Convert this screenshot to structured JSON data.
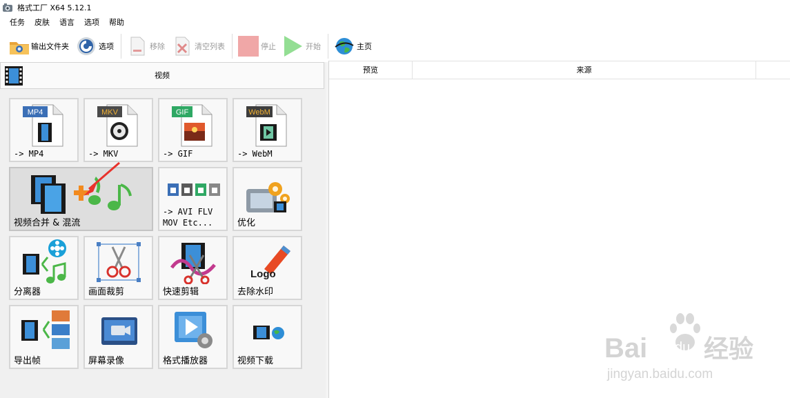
{
  "window": {
    "title": "格式工厂 X64 5.12.1"
  },
  "menu": [
    "任务",
    "皮肤",
    "语言",
    "选项",
    "帮助"
  ],
  "toolbar": {
    "output_folder": "输出文件夹",
    "options": "选项",
    "remove": "移除",
    "clear_list": "清空列表",
    "stop": "停止",
    "start": "开始",
    "home": "主页"
  },
  "category": {
    "title": "视频"
  },
  "tiles": [
    {
      "label": "-> MP4",
      "badge": "MP4",
      "badge_color": "#3b6fb6"
    },
    {
      "label": "-> MKV",
      "badge": "MKV",
      "badge_color": "#4a4a4a"
    },
    {
      "label": "-> GIF",
      "badge": "GIF",
      "badge_color": "#2fa864"
    },
    {
      "label": "-> WebM",
      "badge": "WebM",
      "badge_color": "#3d3d3d"
    },
    {
      "label": "视频合并 & 混流"
    },
    {
      "label_line1": "-> AVI FLV",
      "label_line2": "MOV Etc..."
    },
    {
      "label": "优化"
    },
    {
      "label": "分离器"
    },
    {
      "label": "画面裁剪"
    },
    {
      "label": "快速剪辑"
    },
    {
      "label": "去除水印",
      "logo_text": "Logo"
    },
    {
      "label": "导出帧"
    },
    {
      "label": "屏幕录像"
    },
    {
      "label": "格式播放器"
    },
    {
      "label": "视频下载"
    }
  ],
  "table": {
    "columns": [
      "预览",
      "来源"
    ]
  },
  "watermark": {
    "brand_text": "Bai",
    "brand_text2": "du",
    "cn_text": "经验",
    "url": "jingyan.baidu.com"
  }
}
